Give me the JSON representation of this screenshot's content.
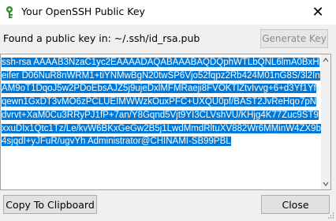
{
  "window": {
    "title": "Your OpenSSH Public Key",
    "close_glyph": "✕"
  },
  "header": {
    "found_label": "Found a public key in: ~/.ssh/id_rsa.pub",
    "generate_button_label": "Generate Key"
  },
  "key": {
    "text": "ssh-rsa AAAAB3NzaC1yc2EAAAADAQABAAABAQDQphWTLbQNL6lmA0BxHeifer D06NuR8nWRM1+tiYNMwBgN20twSP6Vjo52fqpz2Rb424M01nG8S/3l2InAM9oT1DqoJ5w2PDoEbsAJZ5j9ujeDxlMFMRaeji8FVOKTlZtvIvvg+6+d3Yf1Yfqewn1GxDT3vMO6zPCLUEIMWWzkOuxPFC+UXQU0pf/BAST2JvReHqo7pNdvrvt+XaM0Cu3RRyPJ1fP+7an/Y8Gqnd5Vjt9YI3CLVshVU/KHjg4K77Zuc9ST9xxuDIx1Qtc1Tz/Le/kvW6BKxGeGw2B5j1LwdMmdRltuXV882Wr6MMinW4ZX9b4sjqdI+yJFuR/ugvYh Administrator@CHINAMI-SB99PBL"
  },
  "footer": {
    "copy_button_label": "Copy To Clipboard",
    "close_button_label": "Close"
  },
  "colors": {
    "selection": "#0078d7",
    "dialog_bg": "#f0f0f0"
  },
  "icons": [
    "app-key-icon",
    "close-icon",
    "scroll-up-icon",
    "scroll-down-icon",
    "resize-grip-icon"
  ]
}
